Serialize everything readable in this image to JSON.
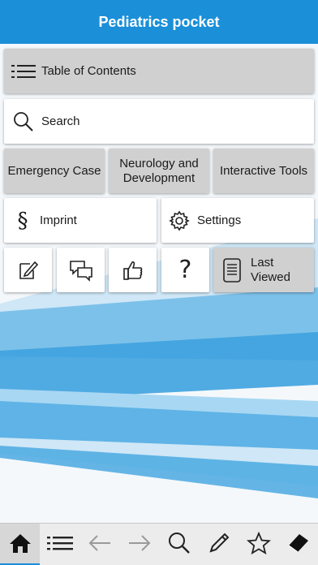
{
  "header": {
    "title": "Pediatrics pocket"
  },
  "menu": {
    "table_of_contents": {
      "label": "Table of Contents",
      "icon": "list-icon"
    },
    "search": {
      "label": "Search",
      "icon": "search-icon"
    },
    "emergency_case": {
      "label": "Emergency Case"
    },
    "neurology": {
      "label_line1": "Neurology and",
      "label_line2": "Development"
    },
    "interactive_tools": {
      "label": "Interactive Tools"
    },
    "imprint": {
      "label": "Imprint",
      "icon": "section-sign-icon"
    },
    "settings": {
      "label": "Settings",
      "icon": "gear-icon"
    },
    "notes": {
      "icon": "edit-note-icon"
    },
    "feedback": {
      "icon": "chat-bubbles-icon"
    },
    "rate": {
      "icon": "thumbs-up-icon"
    },
    "help": {
      "icon": "question-icon",
      "glyph": "?"
    },
    "last_viewed": {
      "label_line1": "Last",
      "label_line2": "Viewed",
      "icon": "document-icon"
    }
  },
  "tabbar": {
    "items": [
      {
        "name": "home",
        "icon": "home-icon",
        "active": true
      },
      {
        "name": "contents",
        "icon": "list-icon"
      },
      {
        "name": "back",
        "icon": "arrow-left-icon"
      },
      {
        "name": "forward",
        "icon": "arrow-right-icon"
      },
      {
        "name": "search",
        "icon": "search-icon"
      },
      {
        "name": "notes",
        "icon": "pencil-icon"
      },
      {
        "name": "favorites",
        "icon": "star-icon"
      },
      {
        "name": "highlighter",
        "icon": "eraser-icon"
      }
    ]
  },
  "colors": {
    "accent": "#1b8fd8",
    "tile_gray": "#d0d0d0",
    "tabbar_bg": "#ececec"
  }
}
